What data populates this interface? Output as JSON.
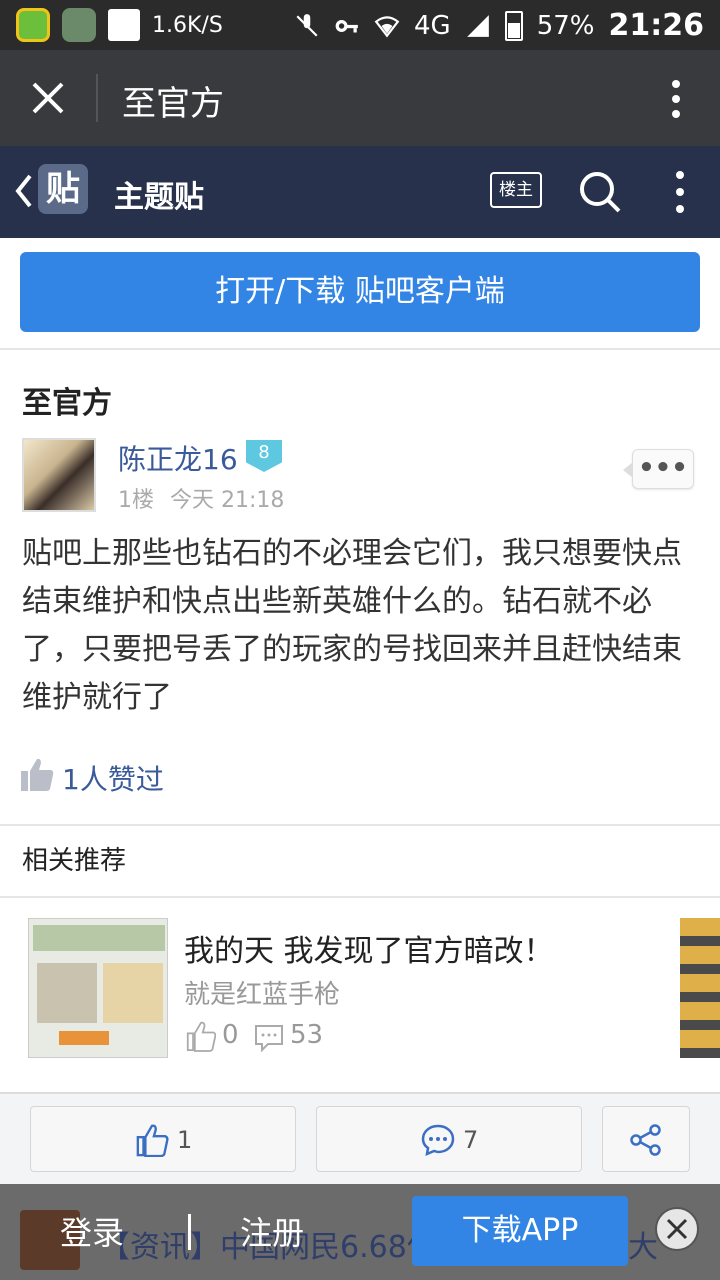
{
  "status_bar": {
    "speed": "1.6K/S",
    "network": "4G",
    "battery": "57%",
    "time": "21:26"
  },
  "title_bar": {
    "title": "至官方"
  },
  "tieba_bar": {
    "logo": "贴",
    "title": "主题贴",
    "louzhu_label": "楼主"
  },
  "open_client_button": "打开/下载 贴吧客户端",
  "thread": {
    "title": "至官方",
    "username": "陈正龙16",
    "level": "8",
    "floor": "1楼",
    "time": "今天 21:18",
    "more_label": "•••",
    "body": "贴吧上那些也钻石的不必理会它们，我只想要快点结束维护和快点出些新英雄什么的。钻石就不必了，只要把号丢了的玩家的号找回来并且赶快结束维护就行了",
    "likes_text": "1人赞过"
  },
  "related": {
    "section_title": "相关推荐",
    "items": [
      {
        "title": "我的天 我发现了官方暗改！",
        "subtitle": "就是红蓝手枪",
        "likes": "0",
        "comments": "53"
      }
    ]
  },
  "action_bar": {
    "like_count": "1",
    "comment_count": "7"
  },
  "bottom_bar": {
    "login": "登录",
    "separator": "|",
    "register": "注册",
    "download": "下载APP",
    "news_text": "【资讯】中国网民6.68亿",
    "news_tail": "大"
  }
}
